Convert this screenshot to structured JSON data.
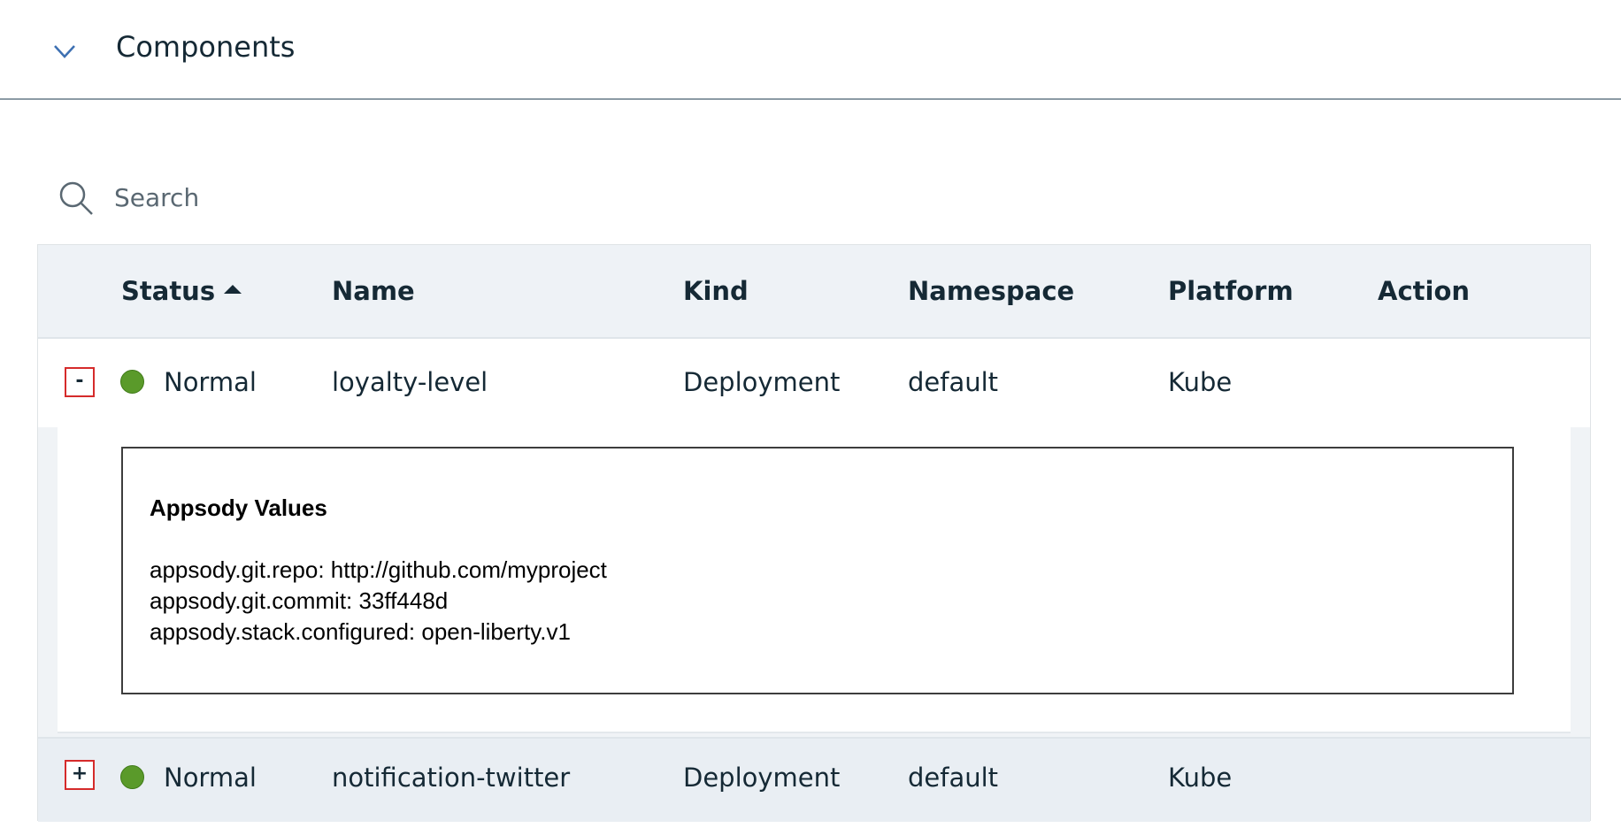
{
  "accordion": {
    "title": "Components",
    "icon": "chevron-down-icon"
  },
  "search": {
    "placeholder": "Search",
    "icon": "search-icon"
  },
  "table": {
    "columns": [
      "Status",
      "Name",
      "Kind",
      "Namespace",
      "Platform",
      "Action"
    ],
    "sorted_column": "Status",
    "sort_direction": "ascending",
    "rows": [
      {
        "toggle": "-",
        "expanded": true,
        "status": "Normal",
        "name": "loyalty-level",
        "kind": "Deployment",
        "namespace": "default",
        "platform": "Kube",
        "action": ""
      },
      {
        "toggle": "+",
        "expanded": false,
        "status": "Normal",
        "name": "notification-twitter",
        "kind": "Deployment",
        "namespace": "default",
        "platform": "Kube",
        "action": ""
      }
    ]
  },
  "details": {
    "title": "Appsody Values",
    "lines": [
      "appsody.git.repo:  http://github.com/myproject",
      "appsody.git.commit: 33ff448d",
      "appsody.stack.configured:  open-liberty.v1"
    ]
  },
  "colors": {
    "status_normal": "#5a9a2a",
    "toggle_border": "#d52b2b",
    "header_bg": "#eef2f6",
    "text": "#152935"
  }
}
